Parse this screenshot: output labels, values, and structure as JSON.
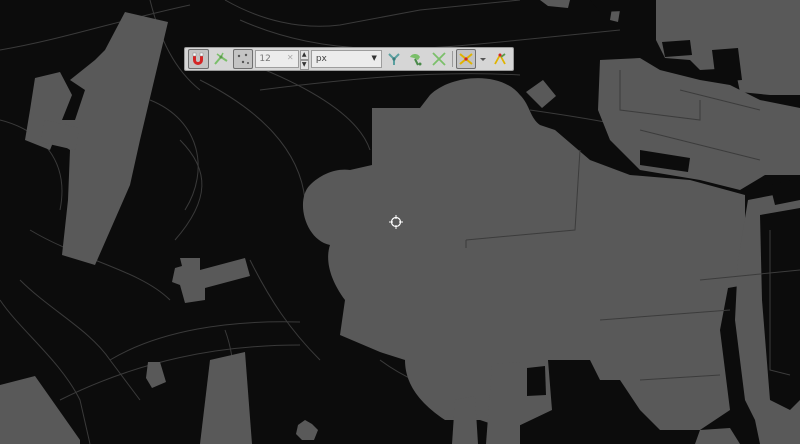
{
  "map": {
    "background": "#0c0c0c",
    "building_fill": "#595959",
    "line_color": "#3c3c3c"
  },
  "toolbar": {
    "snapping_toggle": {
      "icon": "magnet-icon",
      "active": true
    },
    "snap_to_vertex": {
      "icon": "snap-vertex-icon"
    },
    "snap_type": {
      "icon": "snap-points-icon",
      "active": true
    },
    "tolerance": {
      "value": "12",
      "placeholder": "12"
    },
    "units": {
      "value": "px",
      "options": [
        "px"
      ]
    },
    "topological_editing": {
      "icon": "topology-icon"
    },
    "snap_on_intersection": {
      "icon": "intersection-snap-icon"
    },
    "avoid_overlap": {
      "icon": "cross-icon"
    },
    "tracing": {
      "icon": "tracing-icon",
      "active": true
    },
    "enable_tracing_menu": {
      "icon": "tracing-settings-icon"
    }
  }
}
